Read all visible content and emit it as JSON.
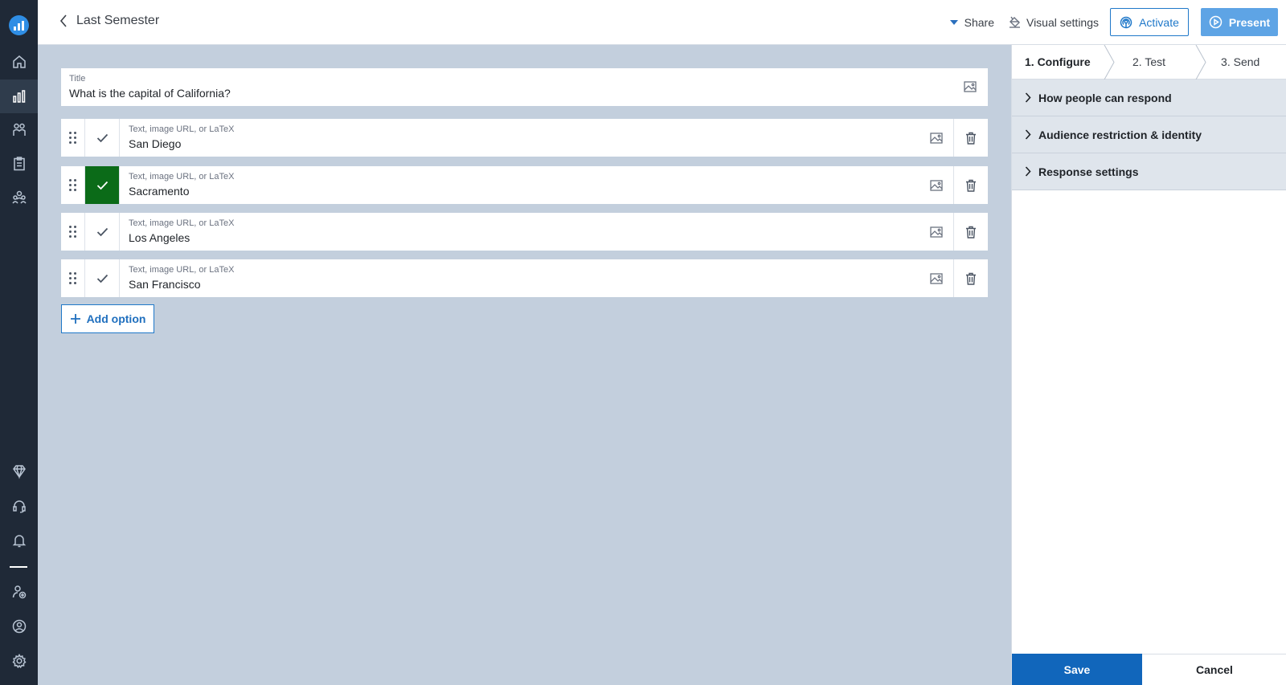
{
  "header": {
    "back_label": "Last Semester",
    "share_label": "Share",
    "visual_settings_label": "Visual settings",
    "activate_label": "Activate",
    "present_label": "Present"
  },
  "sidebar": {
    "items": [
      {
        "icon": "home-icon"
      },
      {
        "icon": "bar-chart-icon",
        "active": true
      },
      {
        "icon": "participants-icon"
      },
      {
        "icon": "clipboard-icon"
      },
      {
        "icon": "team-icon"
      },
      {
        "icon": "diamond-icon"
      },
      {
        "icon": "headset-icon"
      },
      {
        "icon": "bell-icon"
      },
      {
        "icon": "add-user-icon"
      },
      {
        "icon": "account-icon"
      },
      {
        "icon": "gear-icon"
      }
    ]
  },
  "question": {
    "title_label": "Title",
    "title_value": "What is the capital of California?"
  },
  "options": [
    {
      "placeholder": "Text, image URL, or LaTeX",
      "value": "San Diego",
      "correct": false
    },
    {
      "placeholder": "Text, image URL, or LaTeX",
      "value": "Sacramento",
      "correct": true
    },
    {
      "placeholder": "Text, image URL, or LaTeX",
      "value": "Los Angeles",
      "correct": false
    },
    {
      "placeholder": "Text, image URL, or LaTeX",
      "value": "San Francisco",
      "correct": false
    }
  ],
  "add_option_label": "Add option",
  "panel": {
    "steps": [
      "1. Configure",
      "2. Test",
      "3. Send"
    ],
    "active_step": 0,
    "sections": [
      "How people can respond",
      "Audience restriction & identity",
      "Response settings"
    ],
    "save_label": "Save",
    "cancel_label": "Cancel"
  },
  "colors": {
    "accent": "#1f78c9",
    "correct": "#0b6b18",
    "canvas": "#c3cfdd",
    "rail": "#1f2937"
  }
}
